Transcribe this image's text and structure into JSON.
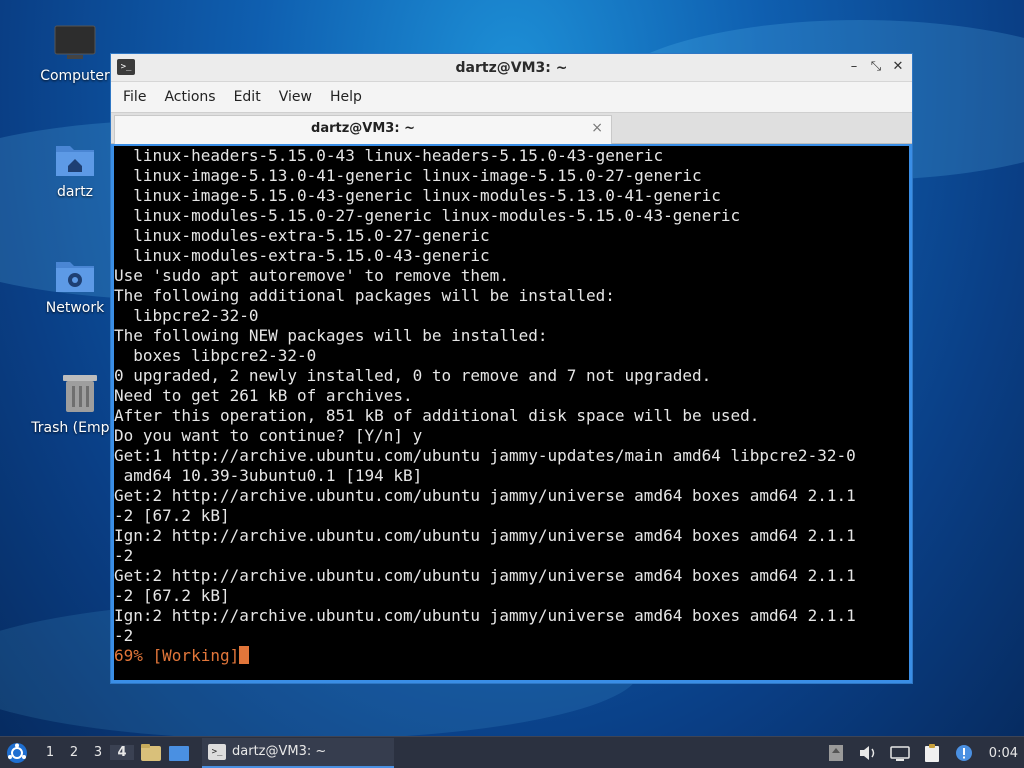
{
  "desktop": {
    "icons": [
      {
        "label": "Computer"
      },
      {
        "label": "dartz"
      },
      {
        "label": "Network"
      },
      {
        "label": "Trash (Empty)"
      }
    ]
  },
  "window": {
    "title": "dartz@VM3: ~",
    "menu": [
      "File",
      "Actions",
      "Edit",
      "View",
      "Help"
    ],
    "tab_label": "dartz@VM3: ~",
    "tab_close": "×"
  },
  "terminal": {
    "lines": [
      "  linux-headers-5.15.0-43 linux-headers-5.15.0-43-generic",
      "  linux-image-5.13.0-41-generic linux-image-5.15.0-27-generic",
      "  linux-image-5.15.0-43-generic linux-modules-5.13.0-41-generic",
      "  linux-modules-5.15.0-27-generic linux-modules-5.15.0-43-generic",
      "  linux-modules-extra-5.15.0-27-generic",
      "  linux-modules-extra-5.15.0-43-generic",
      "Use 'sudo apt autoremove' to remove them.",
      "The following additional packages will be installed:",
      "  libpcre2-32-0",
      "The following NEW packages will be installed:",
      "  boxes libpcre2-32-0",
      "0 upgraded, 2 newly installed, 0 to remove and 7 not upgraded.",
      "Need to get 261 kB of archives.",
      "After this operation, 851 kB of additional disk space will be used.",
      "Do you want to continue? [Y/n] y",
      "Get:1 http://archive.ubuntu.com/ubuntu jammy-updates/main amd64 libpcre2-32-0",
      " amd64 10.39-3ubuntu0.1 [194 kB]",
      "Get:2 http://archive.ubuntu.com/ubuntu jammy/universe amd64 boxes amd64 2.1.1",
      "-2 [67.2 kB]",
      "Ign:2 http://archive.ubuntu.com/ubuntu jammy/universe amd64 boxes amd64 2.1.1",
      "-2",
      "Get:2 http://archive.ubuntu.com/ubuntu jammy/universe amd64 boxes amd64 2.1.1",
      "-2 [67.2 kB]",
      "Ign:2 http://archive.ubuntu.com/ubuntu jammy/universe amd64 boxes amd64 2.1.1",
      "-2"
    ],
    "status_line": "69% [Working]"
  },
  "taskbar": {
    "workspaces": [
      "1",
      "2",
      "3",
      "4"
    ],
    "active_workspace": "4",
    "task_label": "dartz@VM3: ~",
    "clock": "0:04"
  },
  "colors": {
    "accent": "#3a8ee6",
    "status_text": "#e2763a",
    "terminal_bg": "#000000",
    "taskbar_bg": "#2b3140"
  }
}
